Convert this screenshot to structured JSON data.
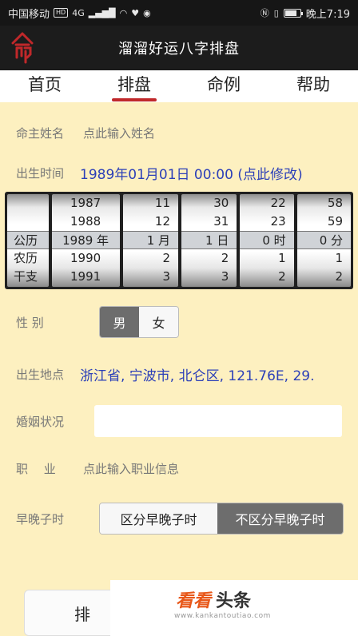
{
  "status_bar": {
    "carrier": "中国移动",
    "hd": "HD",
    "net": "4G",
    "time": "晚上7:19"
  },
  "app": {
    "title": "溜溜好运八字排盘"
  },
  "tabs": [
    {
      "label": "首页",
      "active": false
    },
    {
      "label": "排盘",
      "active": true
    },
    {
      "label": "命例",
      "active": false
    },
    {
      "label": "帮助",
      "active": false
    }
  ],
  "form": {
    "name": {
      "label": "命主姓名",
      "placeholder": "点此输入姓名"
    },
    "birth": {
      "label": "出生时间",
      "value": "1989年01月01日 00:00 (点此修改)"
    },
    "gender": {
      "label": "性 别",
      "male": "男",
      "female": "女",
      "selected": "男"
    },
    "birthplace": {
      "label": "出生地点",
      "value": "浙江省, 宁波市, 北仑区, 121.76E, 29."
    },
    "marriage": {
      "label": "婚姻状况",
      "value": ""
    },
    "job": {
      "label": "职　 业",
      "placeholder": "点此输入职业信息"
    },
    "zi": {
      "label": "早晚子时",
      "opt1": "区分早晚子时",
      "opt2": "不区分早晚子时",
      "selected": "不区分早晚子时"
    }
  },
  "picker": {
    "side": [
      "",
      "",
      "公历",
      "农历",
      "干支"
    ],
    "year": [
      "1987",
      "1988",
      "1989 年",
      "1990",
      "1991"
    ],
    "month": [
      "11",
      "12",
      "1 月",
      "2",
      "3"
    ],
    "day": [
      "30",
      "31",
      "1 日",
      "2",
      "3"
    ],
    "hour": [
      "22",
      "23",
      "0 时",
      "1",
      "2"
    ],
    "minute": [
      "58",
      "59",
      "0 分",
      "1",
      "2"
    ]
  },
  "bottom": {
    "button": "排"
  },
  "watermark": {
    "kan": "看看",
    "toutiao": "头条",
    "url": "www.kankantoutiao.com"
  },
  "colors": {
    "accent": "#c0282a",
    "link": "#2b3fb8",
    "background": "#fdf0c0"
  }
}
